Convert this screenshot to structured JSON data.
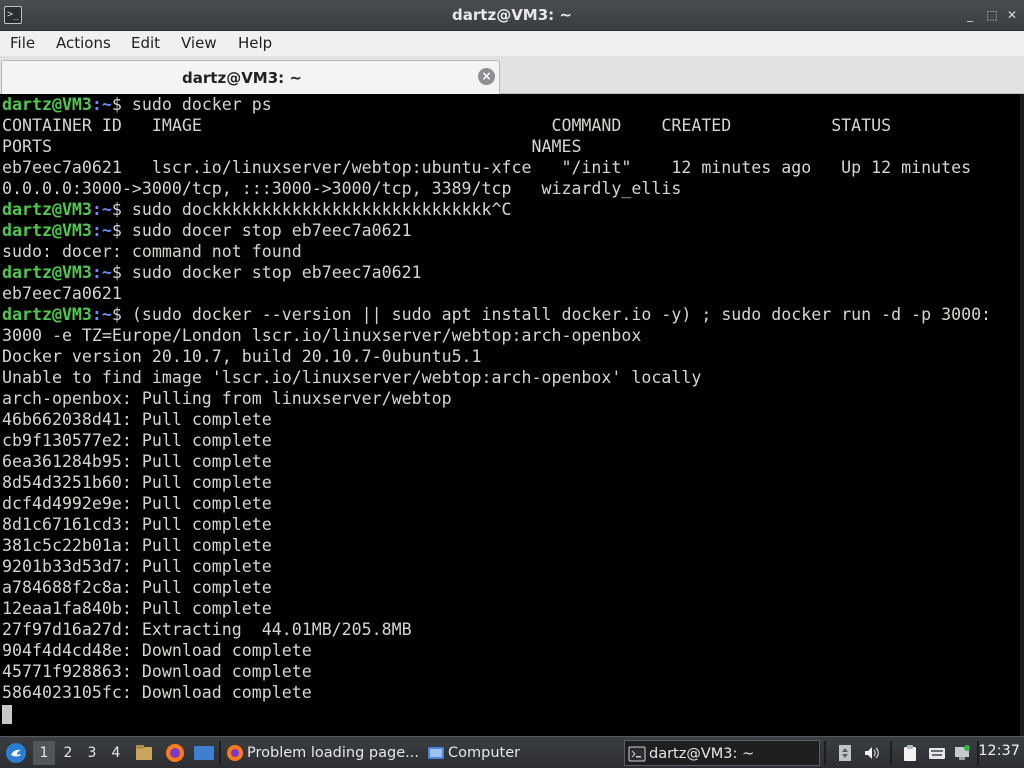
{
  "window": {
    "title": "dartz@VM3: ~",
    "controls": [
      "minimize",
      "maximize",
      "close"
    ]
  },
  "menu": [
    "File",
    "Actions",
    "Edit",
    "View",
    "Help"
  ],
  "tab": {
    "label": "dartz@VM3: ~"
  },
  "terminal": {
    "prompt_user": "dartz@VM3",
    "prompt_path": ":~",
    "lines": [
      {
        "type": "prompt",
        "cmd": "$ sudo docker ps"
      },
      {
        "type": "out",
        "text": "CONTAINER ID   IMAGE                                   COMMAND    CREATED          STATUS"
      },
      {
        "type": "out",
        "text": "PORTS                                                NAMES"
      },
      {
        "type": "out",
        "text": "eb7eec7a0621   lscr.io/linuxserver/webtop:ubuntu-xfce   \"/init\"    12 minutes ago   Up 12 minutes"
      },
      {
        "type": "out",
        "text": "0.0.0.0:3000->3000/tcp, :::3000->3000/tcp, 3389/tcp   wizardly_ellis"
      },
      {
        "type": "prompt",
        "cmd": "$ sudo dockkkkkkkkkkkkkkkkkkkkkkkkkkkk^C"
      },
      {
        "type": "prompt",
        "cmd": "$ sudo docer stop eb7eec7a0621"
      },
      {
        "type": "out",
        "text": "sudo: docer: command not found"
      },
      {
        "type": "prompt",
        "cmd": "$ sudo docker stop eb7eec7a0621"
      },
      {
        "type": "out",
        "text": "eb7eec7a0621"
      },
      {
        "type": "prompt",
        "cmd": "$ (sudo docker --version || sudo apt install docker.io -y) ; sudo docker run -d -p 3000:"
      },
      {
        "type": "out",
        "text": "3000 -e TZ=Europe/London lscr.io/linuxserver/webtop:arch-openbox"
      },
      {
        "type": "out",
        "text": "Docker version 20.10.7, build 20.10.7-0ubuntu5.1"
      },
      {
        "type": "out",
        "text": "Unable to find image 'lscr.io/linuxserver/webtop:arch-openbox' locally"
      },
      {
        "type": "out",
        "text": "arch-openbox: Pulling from linuxserver/webtop"
      },
      {
        "type": "out",
        "text": "46b662038d41: Pull complete"
      },
      {
        "type": "out",
        "text": "cb9f130577e2: Pull complete"
      },
      {
        "type": "out",
        "text": "6ea361284b95: Pull complete"
      },
      {
        "type": "out",
        "text": "8d54d3251b60: Pull complete"
      },
      {
        "type": "out",
        "text": "dcf4d4992e9e: Pull complete"
      },
      {
        "type": "out",
        "text": "8d1c67161cd3: Pull complete"
      },
      {
        "type": "out",
        "text": "381c5c22b01a: Pull complete"
      },
      {
        "type": "out",
        "text": "9201b33d53d7: Pull complete"
      },
      {
        "type": "out",
        "text": "a784688f2c8a: Pull complete"
      },
      {
        "type": "out",
        "text": "12eaa1fa840b: Pull complete"
      },
      {
        "type": "out",
        "text": "27f97d16a27d: Extracting  44.01MB/205.8MB"
      },
      {
        "type": "out",
        "text": "904f4d4cd48e: Download complete"
      },
      {
        "type": "out",
        "text": "45771f928863: Download complete"
      },
      {
        "type": "out",
        "text": "5864023105fc: Download complete"
      },
      {
        "type": "cursor"
      }
    ]
  },
  "taskbar": {
    "workspaces": [
      "1",
      "2",
      "3",
      "4"
    ],
    "active_workspace": "1",
    "tasks": [
      {
        "label": "Problem loading page...",
        "icon": "firefox-icon"
      },
      {
        "label": "Computer",
        "icon": "folder-icon"
      },
      {
        "label": "dartz@VM3: ~",
        "icon": "terminal-icon",
        "active": true
      }
    ],
    "clock": "12:37"
  },
  "colors": {
    "prompt_user": "#4ec94e",
    "prompt_path": "#6b8cff",
    "terminal_bg": "#000000",
    "terminal_fg": "#d3d7cf"
  }
}
